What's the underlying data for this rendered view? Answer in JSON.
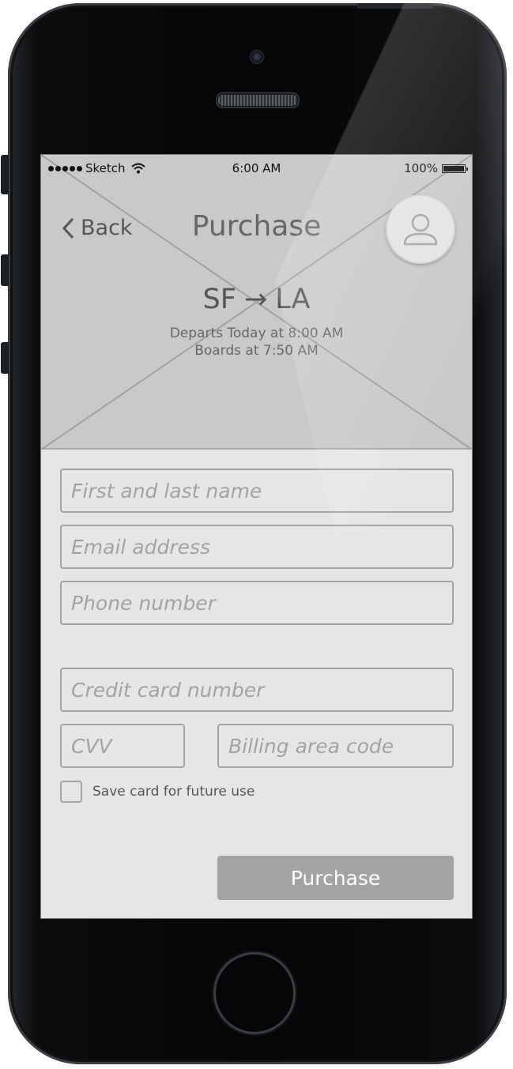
{
  "status_bar": {
    "carrier": "Sketch",
    "time": "6:00 AM",
    "battery": "100%",
    "signal_icon": "signal-dots-icon",
    "wifi_icon": "wifi-icon",
    "battery_icon": "battery-icon"
  },
  "nav": {
    "back_label": "Back",
    "back_icon": "chevron-left-icon",
    "title": "Purchase",
    "avatar_icon": "user-icon"
  },
  "trip": {
    "origin": "SF",
    "destination": "LA",
    "arrow": "→",
    "departs": "Departs Today at 8:00 AM",
    "boards": "Boards at 7:50 AM"
  },
  "form": {
    "name_placeholder": "First and last name",
    "email_placeholder": "Email address",
    "phone_placeholder": "Phone number",
    "card_placeholder": "Credit card number",
    "cvv_placeholder": "CVV",
    "billing_placeholder": "Billing area code",
    "save_card_label": "Save card for future use",
    "save_card_checked": false,
    "submit_label": "Purchase"
  },
  "colors": {
    "hero_bg": "#c9c9c9",
    "screen_bg": "#e6e6e6",
    "border": "#a3a3a3",
    "button_bg": "#a3a3a3",
    "placeholder_text": "#a2a2a2"
  }
}
